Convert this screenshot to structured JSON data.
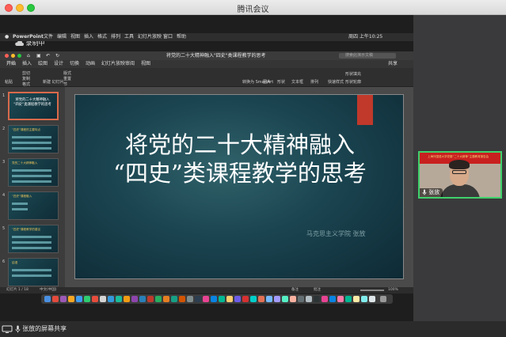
{
  "window": {
    "title": "腾讯会议"
  },
  "recording": {
    "label": "录制中"
  },
  "menubar": {
    "app": "PowerPoint",
    "items": [
      "文件",
      "编辑",
      "视图",
      "插入",
      "格式",
      "排列",
      "工具",
      "幻灯片放映",
      "窗口",
      "帮助"
    ],
    "clock": "周四 上午10:25"
  },
  "ppt": {
    "doc_title": "将党的二十大精神融入\"四史\"类课程教学的思考",
    "search_placeholder": "搜索此演示文稿",
    "share_label": "共享",
    "tabs": [
      "开始",
      "插入",
      "绘图",
      "设计",
      "切换",
      "动画",
      "幻灯片放映",
      "审阅",
      "视图"
    ],
    "ribbon": {
      "paste": "粘贴",
      "cut": "剪切",
      "copy": "复制",
      "format": "格式",
      "new_slide": "新建\n幻灯片",
      "layout": "版式",
      "reset": "重置",
      "section": "节",
      "convert": "转换为\nSmartArt",
      "picture": "图片",
      "shape": "形状",
      "textbox": "文本框",
      "arrange": "排列",
      "quickstyle": "快速样式",
      "fill": "形状填充",
      "outline": "形状轮廓"
    },
    "thumbnails": [
      {
        "num": "1",
        "text": "将党的二十大精神融入\n“四史”类课程教学的思考"
      },
      {
        "num": "2",
        "text": "“四史”课程的主要特点"
      },
      {
        "num": "3",
        "text": "党的二十大精神融入"
      },
      {
        "num": "4",
        "text": "“四史”课程融入"
      },
      {
        "num": "5",
        "text": "“四史”课程教学的建议"
      },
      {
        "num": "6",
        "text": "结语"
      }
    ],
    "slide": {
      "title_line1": "将党的二十大精神融入",
      "title_line2": "“四史”类课程教学的思考",
      "author": "马克思主义学院 张放"
    },
    "status": {
      "slide_count": "幻灯片 1 / 18",
      "language": "中文(中国)",
      "notes": "备注",
      "comments": "批注",
      "zoom": "100%"
    }
  },
  "camera": {
    "name": "张放",
    "banner": "上海外国语大学党委“二十大精神”主题教育报告会"
  },
  "footer": {
    "share_label": "张放的屏幕共享"
  },
  "colors": {
    "accent_green": "#3fd16b",
    "slide_red": "#c0392b",
    "banner_red": "#c8201f"
  }
}
